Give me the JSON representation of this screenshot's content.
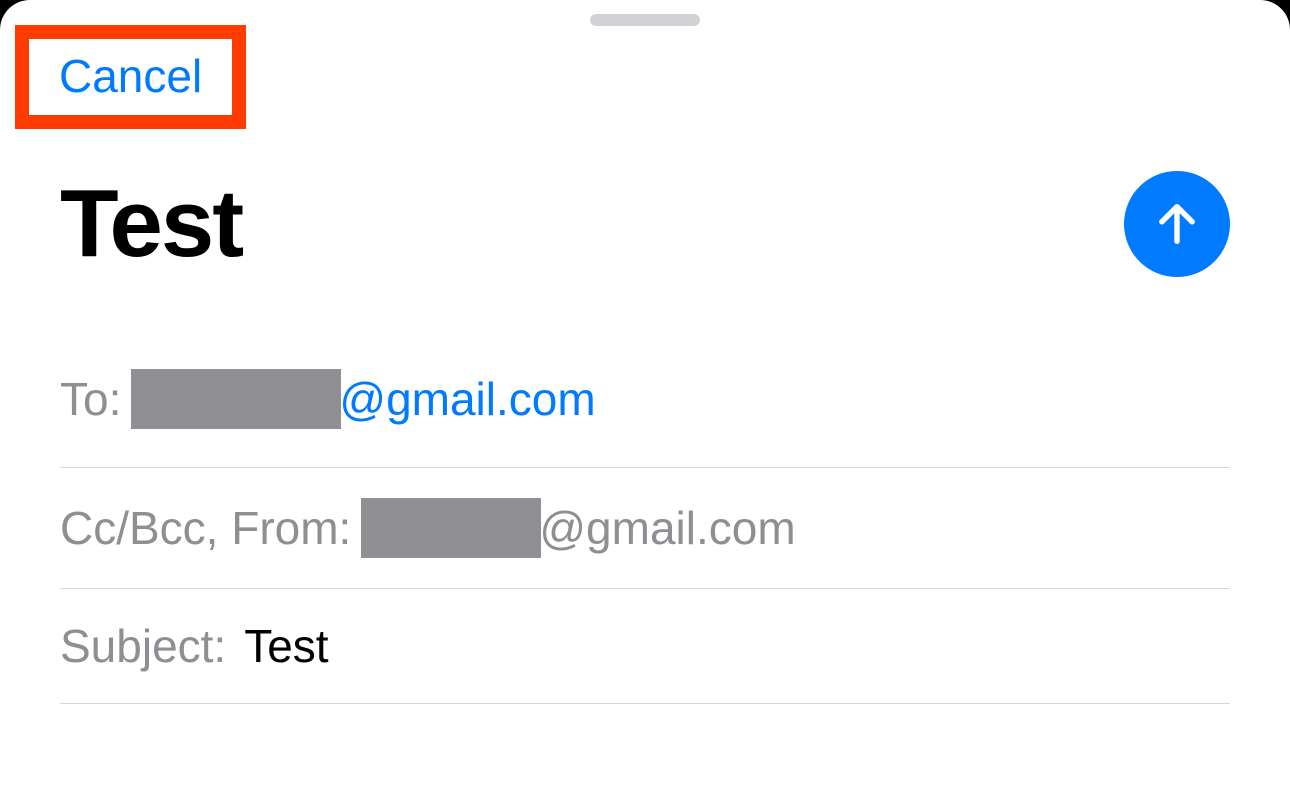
{
  "header": {
    "cancel_label": "Cancel"
  },
  "compose": {
    "title": "Test"
  },
  "fields": {
    "to_label": "To:",
    "to_domain": "@gmail.com",
    "ccbcc_from_label": "Cc/Bcc, From:",
    "from_domain": "@gmail.com",
    "subject_label": "Subject:",
    "subject_value": "Test"
  },
  "colors": {
    "accent": "#007aff",
    "highlight": "#ff3b00",
    "muted": "#8e8e93"
  }
}
